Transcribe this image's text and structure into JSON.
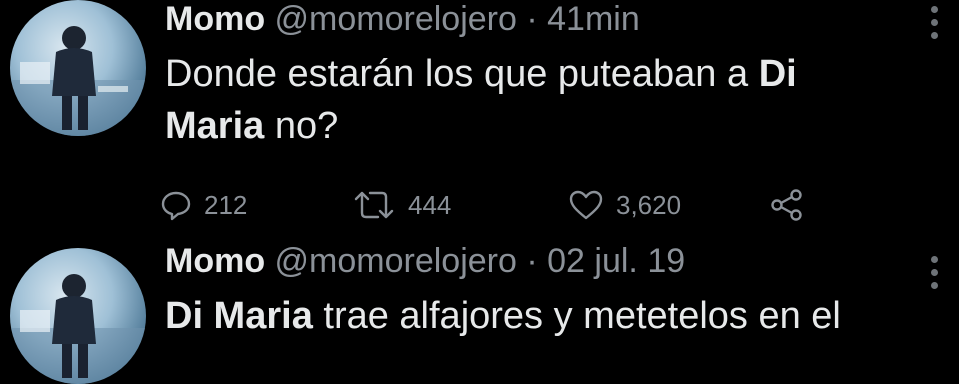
{
  "tweets": [
    {
      "name": "Momo",
      "handle": "@momorelojero",
      "separator": " · ",
      "time": "41min",
      "text_parts": [
        "Donde estarán los que puteaban a ",
        "Di",
        " ",
        "Maria",
        " no?"
      ],
      "replies": "212",
      "retweets": "444",
      "likes": "3,620"
    },
    {
      "name": "Momo",
      "handle": "@momorelojero",
      "separator": " · ",
      "time": "02 jul. 19",
      "text_parts": [
        "Di Maria",
        " trae alfajores y metetelos en el"
      ]
    }
  ],
  "icons": {
    "reply": "reply-icon",
    "retweet": "retweet-icon",
    "like": "heart-icon",
    "share": "share-icon",
    "more": "more-icon"
  },
  "colors": {
    "background": "#000000",
    "text": "#e7e9ea",
    "secondary": "#8b9198"
  }
}
